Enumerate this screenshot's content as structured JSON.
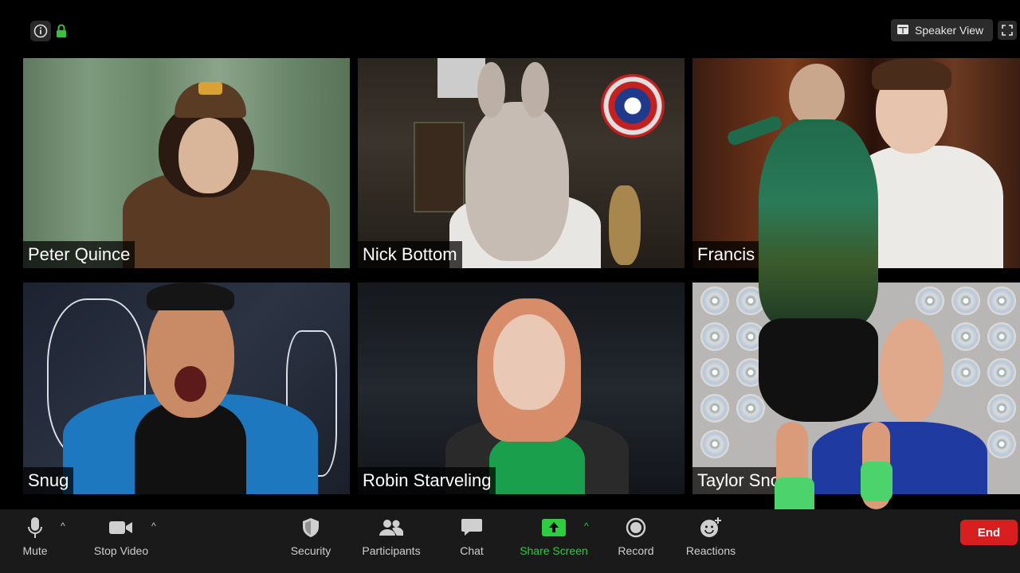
{
  "top_bar": {
    "speaker_view_label": "Speaker View"
  },
  "participants": [
    {
      "name": "Peter Quince"
    },
    {
      "name": "Nick Bottom"
    },
    {
      "name": "Francis"
    },
    {
      "name": "Snug"
    },
    {
      "name": "Robin Starveling"
    },
    {
      "name": "Taylor Snout"
    }
  ],
  "toolbar": {
    "mute_label": "Mute",
    "stop_video_label": "Stop Video",
    "security_label": "Security",
    "participants_label": "Participants",
    "chat_label": "Chat",
    "share_screen_label": "Share Screen",
    "record_label": "Record",
    "reactions_label": "Reactions",
    "end_label": "End"
  },
  "colors": {
    "share_green": "#2ecc40",
    "end_red": "#d81e1e",
    "toolbar_bg": "#1a1a1a",
    "lock_green": "#3fbf3f"
  }
}
